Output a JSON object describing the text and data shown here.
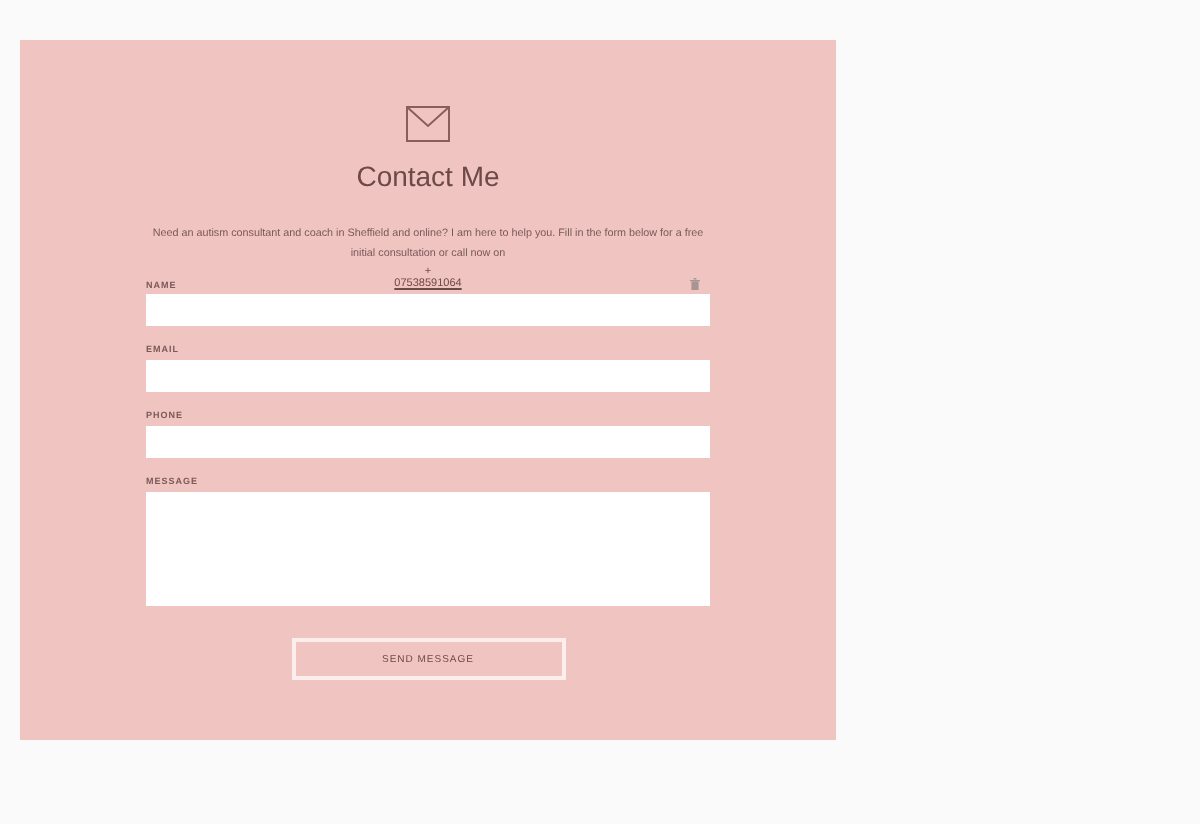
{
  "heading": "Contact Me",
  "intro": "Need an autism consultant and coach in Sheffield and online? I am here to help you. Fill in the form below for a free initial consultation or call now on",
  "plus": "+",
  "phone_link": "07538591064",
  "fields": [
    {
      "label": "NAME",
      "kind": "input"
    },
    {
      "label": "EMAIL",
      "kind": "input"
    },
    {
      "label": "PHONE",
      "kind": "input"
    },
    {
      "label": "MESSAGE",
      "kind": "textarea"
    }
  ],
  "submit": "SEND MESSAGE"
}
